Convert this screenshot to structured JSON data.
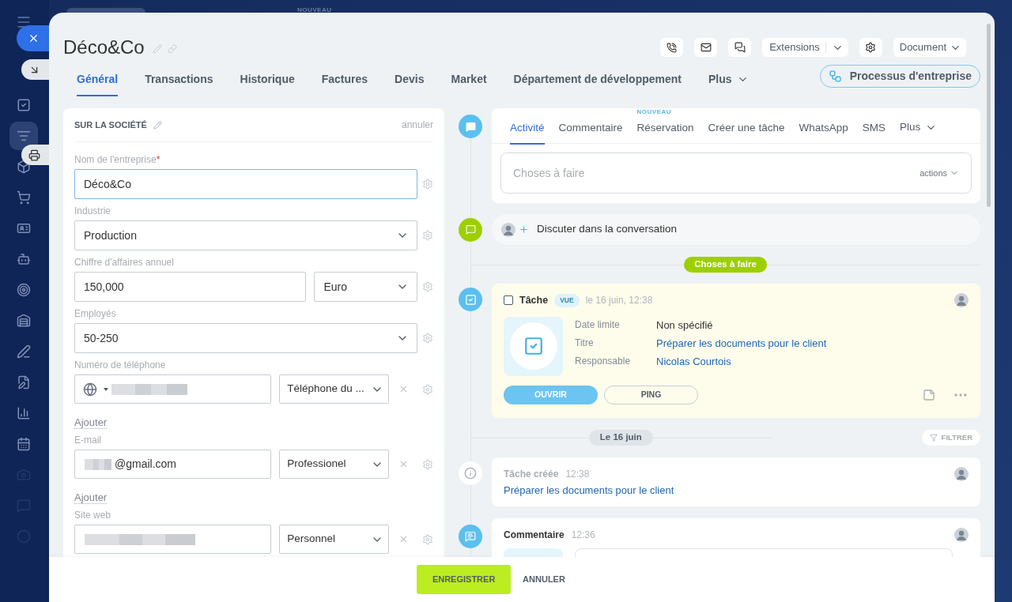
{
  "background": {
    "badge": "NOUVEAU"
  },
  "sidebar": {
    "items": [
      {
        "selected": false,
        "dimmed": false
      },
      {
        "selected": true,
        "dimmed": false
      },
      {
        "selected": false,
        "dimmed": false
      },
      {
        "selected": false,
        "dimmed": false
      },
      {
        "selected": false,
        "dimmed": false
      },
      {
        "selected": false,
        "dimmed": false
      },
      {
        "selected": false,
        "dimmed": false
      },
      {
        "selected": false,
        "dimmed": false
      },
      {
        "selected": false,
        "dimmed": false
      },
      {
        "selected": false,
        "dimmed": false
      },
      {
        "selected": false,
        "dimmed": false
      },
      {
        "selected": false,
        "dimmed": false
      },
      {
        "selected": false,
        "dimmed": true
      },
      {
        "selected": false,
        "dimmed": true
      },
      {
        "selected": false,
        "dimmed": true
      }
    ]
  },
  "header": {
    "title": "Déco&Co",
    "extensions": "Extensions",
    "document": "Document",
    "tabs": [
      {
        "label": "Général",
        "selected": true,
        "kind": "tab"
      },
      {
        "label": "Transactions",
        "selected": false,
        "kind": "tab"
      },
      {
        "label": "Historique",
        "selected": false,
        "kind": "tab"
      },
      {
        "label": "Factures",
        "selected": false,
        "kind": "tab"
      },
      {
        "label": "Devis",
        "selected": false,
        "kind": "tab"
      },
      {
        "label": "Market",
        "selected": false,
        "kind": "tab"
      },
      {
        "label": "Département de développement",
        "selected": false,
        "kind": "tab"
      },
      {
        "label": "Plus",
        "selected": false,
        "kind": "more"
      }
    ],
    "process_button": "Processus d'entreprise"
  },
  "company_card": {
    "title": "SUR LA SOCIÉTÉ",
    "cancel": "annuler",
    "fields": [
      {
        "kind": "text",
        "label": "Nom de l'entreprise",
        "required_mark": "*",
        "value": "Déco&Co",
        "focused": true
      },
      {
        "kind": "select",
        "label": "Industrie",
        "value": "Production"
      },
      {
        "kind": "amount",
        "label": "Chiffre d'affaires annuel",
        "value": "150,000",
        "currency": "Euro"
      },
      {
        "kind": "select",
        "label": "Employés",
        "value": "50-250"
      },
      {
        "kind": "multi",
        "label": "Numéro de téléphone",
        "country_picker": true,
        "redacted": true,
        "type": "Téléphone du ...",
        "add_link": "Ajouter"
      },
      {
        "kind": "multi",
        "label": "E-mail",
        "redacted": true,
        "value": "@gmail.com",
        "type": "Professionel",
        "add_link": "Ajouter"
      },
      {
        "kind": "multi",
        "label": "Site web",
        "redacted": true,
        "type": "Personnel"
      }
    ]
  },
  "timeline": {
    "composer": {
      "tabs": [
        {
          "label": "Activité",
          "selected": true,
          "kind": "tab"
        },
        {
          "label": "Commentaire",
          "selected": false,
          "kind": "tab"
        },
        {
          "label": "Réservation",
          "selected": false,
          "kind": "tab",
          "badge": "NOUVEAU"
        },
        {
          "label": "Créer une tâche",
          "selected": false,
          "kind": "tab"
        },
        {
          "label": "WhatsApp",
          "selected": false,
          "kind": "tab"
        },
        {
          "label": "SMS",
          "selected": false,
          "kind": "tab"
        },
        {
          "label": "Plus",
          "selected": false,
          "kind": "more"
        }
      ],
      "placeholder": "Choses à faire",
      "actions": "actions"
    },
    "chat": "Discuter dans la conversation",
    "todo_divider": "Choses à faire",
    "task": {
      "checked": false,
      "title": "Tâche",
      "badge": "VUE",
      "time": "le 16 juin, 12:38",
      "details": [
        {
          "label": "Date limite",
          "value": "Non spécifié",
          "link": false
        },
        {
          "label": "Titre",
          "value": "Préparer les documents pour le client",
          "link": true
        },
        {
          "label": "Responsable",
          "value": "Nicolas Courtois",
          "link": true
        }
      ],
      "open_button": "OUVRIR",
      "ping_button": "PING"
    },
    "date_divider": "Le 16 juin",
    "filter": "FILTRER",
    "log": {
      "title": "Tâche créée",
      "time": "12:38",
      "link": "Préparer les documents pour le client"
    },
    "comment": {
      "title": "Commentaire",
      "time": "12:36"
    }
  },
  "footer": {
    "save": "ENREGISTRER",
    "cancel": "ANNULER"
  }
}
